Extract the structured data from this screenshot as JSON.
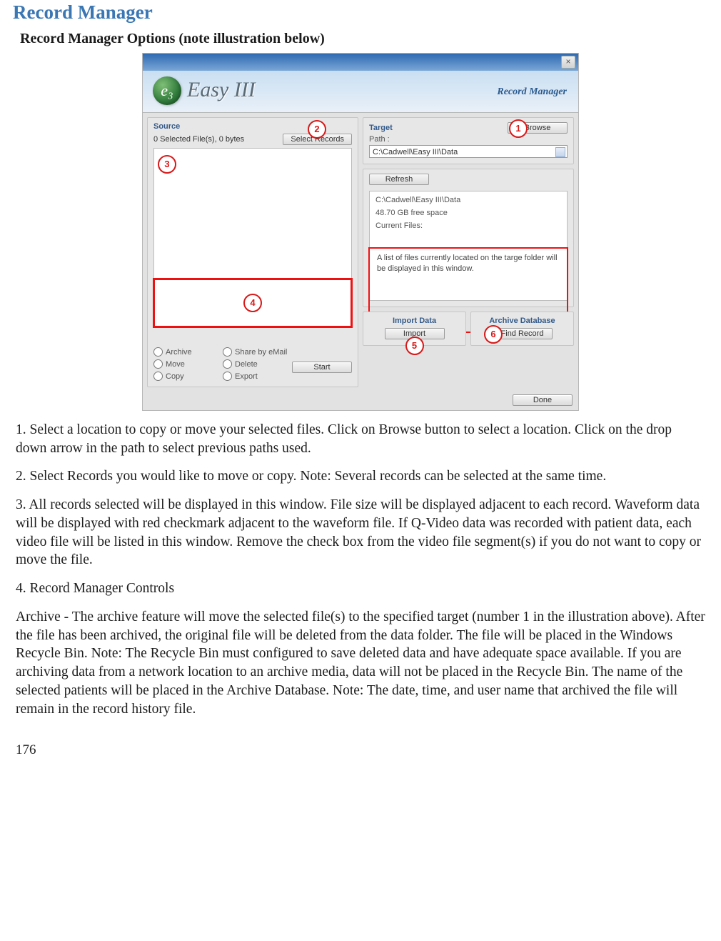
{
  "doc": {
    "title": "Record Manager",
    "subtitle": "Record Manager Options (note illustration below)",
    "page_number": "176"
  },
  "screenshot": {
    "header_app_name": "Easy III",
    "header_label": "Record Manager",
    "close_symbol": "×",
    "source": {
      "group_title": "Source",
      "status": "0 Selected File(s), 0 bytes",
      "select_records_btn": "Select Records",
      "radios": {
        "archive": "Archive",
        "move": "Move",
        "copy": "Copy",
        "share": "Share by eMail",
        "delete": "Delete",
        "export": "Export"
      },
      "start_btn": "Start"
    },
    "target": {
      "group_title": "Target",
      "path_label": "Path :",
      "browse_btn": "Browse",
      "path_value": "C:\\Cadwell\\Easy III\\Data",
      "refresh_btn": "Refresh",
      "info_path": "C:\\Cadwell\\Easy III\\Data",
      "free_space": "48.70 GB free space",
      "current_files_label": "Current Files:",
      "file_list_note": "A list of files currently located on the targe folder will be displayed in this window."
    },
    "import": {
      "group_title": "Import Data",
      "import_btn": "Import"
    },
    "archive_db": {
      "group_title": "Archive Database",
      "find_btn": "Find Record"
    },
    "done_btn": "Done",
    "badges": {
      "b1": "1",
      "b2": "2",
      "b3": "3",
      "b4": "4",
      "b5": "5",
      "b6": "6"
    }
  },
  "body": {
    "p1": "1.  Select a location to copy or move your selected files.  Click on Browse button to select a location.  Click on the drop down arrow in the path to select previous paths used.",
    "p2": "2.  Select Records you would like to move or copy.  Note:  Several records can be selected at the same time.",
    "p3": "3.  All records selected will be displayed in this window.  File size will be displayed adjacent to each record.  Waveform data will be displayed with red checkmark adjacent to the waveform file.  If Q-Video data was recorded with patient data, each video file will be listed in this window.  Remove the check box from the video file segment(s) if you do not want to copy or move the file.",
    "p4": "4.  Record Manager Controls",
    "p5": "Archive - The archive feature will move the selected file(s) to the specified target (number 1 in the illustration above).  After the file has been archived, the original file will be deleted from the data folder.  The file will be placed in the Windows Recycle Bin.  Note:  The Recycle Bin must configured to save deleted data and have adequate space available.  If you are archiving data from a network location to an archive media, data will not be placed in the Recycle Bin.  The name of the selected patients will be placed in the Archive Database.  Note:  The date, time, and user name that archived the file will remain in the record history file."
  }
}
